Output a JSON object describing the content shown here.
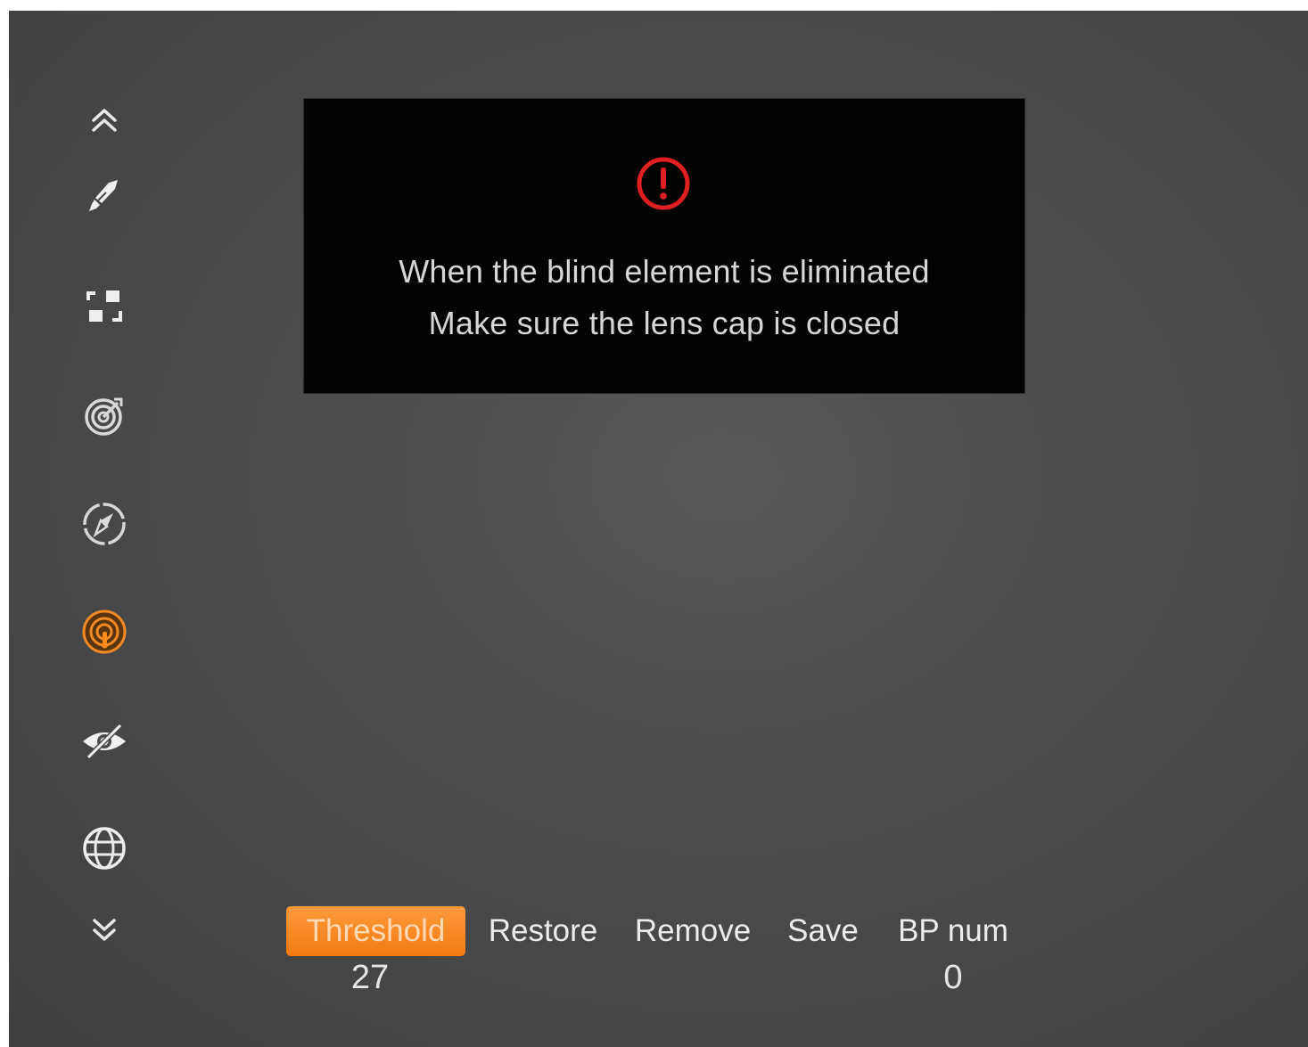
{
  "sidebar": {
    "items": [
      {
        "icon": "chevron-double-up-icon"
      },
      {
        "icon": "brush-icon"
      },
      {
        "icon": "zoom-focus-icon"
      },
      {
        "icon": "target-icon"
      },
      {
        "icon": "compass-icon"
      },
      {
        "icon": "blind-pixel-icon",
        "active": true
      },
      {
        "icon": "eye-off-icon"
      },
      {
        "icon": "globe-icon"
      },
      {
        "icon": "chevron-double-down-icon"
      }
    ]
  },
  "dialog": {
    "line1": "When the blind element is eliminated",
    "line2": "Make sure the lens cap is closed",
    "icon": "alert-circle-icon",
    "icon_color": "#e02020"
  },
  "menu": {
    "threshold_label": "Threshold",
    "restore_label": "Restore",
    "remove_label": "Remove",
    "save_label": "Save",
    "bpnum_label": "BP num",
    "threshold_value": "27",
    "bpnum_value": "0"
  },
  "colors": {
    "accent": "#f5841f",
    "background": "#4b4b4b",
    "text": "#e6e6e6"
  }
}
